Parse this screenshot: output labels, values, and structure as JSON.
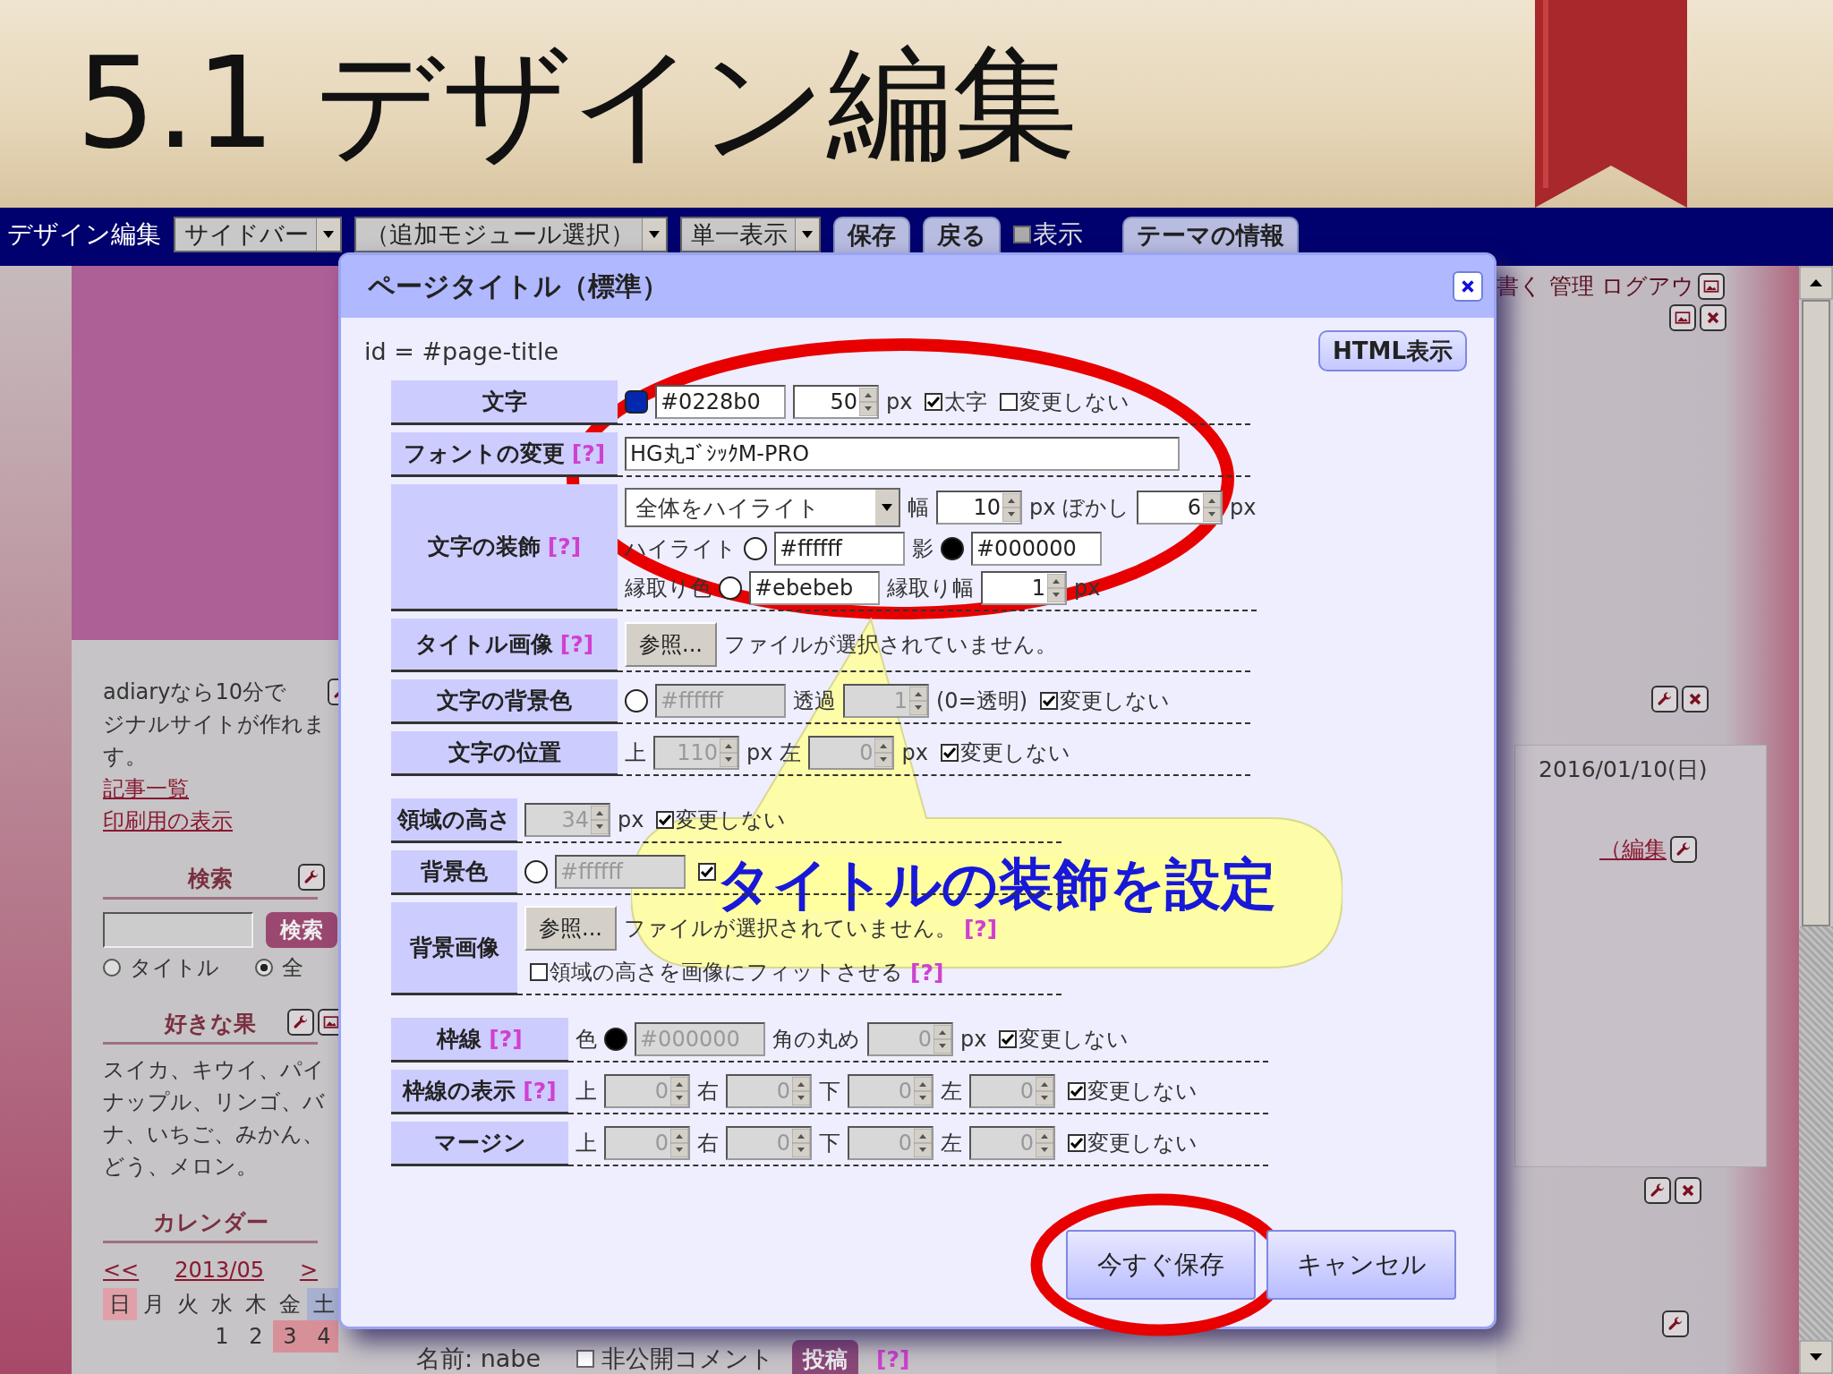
{
  "slide": {
    "title": "5.1 デザイン編集"
  },
  "toolbar": {
    "items": [
      {
        "kind": "label",
        "text": "デザイン編集"
      },
      {
        "kind": "select",
        "text": "サイドバー"
      },
      {
        "kind": "select",
        "text": "（追加モジュール選択）"
      },
      {
        "kind": "select",
        "text": "単一表示"
      },
      {
        "kind": "button",
        "text": "保存"
      },
      {
        "kind": "button",
        "text": "戻る"
      },
      {
        "kind": "checkbox",
        "text": "表示",
        "checked": false
      },
      {
        "kind": "button",
        "text": "テーマの情報"
      }
    ]
  },
  "sidebar": {
    "intro_lines": [
      "adiaryなら10分で",
      "ジナルサイトが作れま",
      "す。"
    ],
    "links": [
      "記事一覧",
      "印刷用の表示"
    ],
    "search": {
      "title": "検索",
      "button": "検索",
      "options": [
        {
          "label": "タイトル",
          "selected": false
        },
        {
          "label": "全",
          "selected": true
        }
      ]
    },
    "fruits": {
      "title": "好きな果",
      "lines": [
        "スイカ、キウイ、パイ",
        "ナップル、リンゴ、バ",
        "ナ、いちご、みかん、",
        "どう、メロン。"
      ]
    },
    "calendar": {
      "title": "カレンダー",
      "prev": "<<",
      "month": "2013/05",
      "next": ">",
      "weekdays": [
        {
          "label": "日",
          "kind": "sunday"
        },
        {
          "label": "月",
          "kind": "weekday"
        },
        {
          "label": "火",
          "kind": "weekday"
        },
        {
          "label": "水",
          "kind": "weekday"
        },
        {
          "label": "木",
          "kind": "weekday"
        },
        {
          "label": "金",
          "kind": "weekday"
        },
        {
          "label": "土",
          "kind": "saturday"
        }
      ],
      "week": [
        {
          "kind": "blank"
        },
        {
          "kind": "blank"
        },
        {
          "kind": "blank"
        },
        {
          "kind": "day",
          "label": "1",
          "holiday": false
        },
        {
          "kind": "day",
          "label": "2",
          "holiday": false
        },
        {
          "kind": "day",
          "label": "3",
          "holiday": true
        },
        {
          "kind": "day",
          "label": "4",
          "holiday": true
        }
      ]
    }
  },
  "right_panel": {
    "user_links": "書く 管理 ログアウ",
    "date": "2016/01/10(日)",
    "edit_link": "（編集"
  },
  "comment_form": {
    "name_label": "名前: nabe",
    "private": {
      "label": "非公開コメント",
      "checked": false
    },
    "submit": "投稿",
    "help": "[?]"
  },
  "dialog": {
    "title": "ページタイトル（標準）",
    "id_text": "id = #page-title",
    "html_button": "HTML表示",
    "groups": [
      {
        "rows": [
          {
            "label": "文字",
            "lines": [
              [
                {
                  "kind": "chip",
                  "color": "#0228b0"
                },
                {
                  "kind": "input",
                  "value": "#0228b0",
                  "disabled": false
                },
                {
                  "kind": "spin",
                  "value": "50",
                  "disabled": false
                },
                {
                  "kind": "text",
                  "label": "px"
                },
                {
                  "kind": "check",
                  "label": "太字",
                  "checked": true
                },
                {
                  "kind": "check",
                  "label": "変更しない",
                  "checked": false
                }
              ]
            ]
          },
          {
            "label": "フォントの変更",
            "help": "[?]",
            "lines": [
              [
                {
                  "kind": "textfield",
                  "value": "HG丸ｺﾞｼｯｸM-PRO",
                  "disabled": false
                }
              ]
            ]
          },
          {
            "label": "文字の装飾",
            "help": "[?]",
            "lines": [
              [
                {
                  "kind": "select",
                  "value": "全体をハイライト"
                },
                {
                  "kind": "text",
                  "label": "幅"
                },
                {
                  "kind": "spin",
                  "value": "10",
                  "disabled": false
                },
                {
                  "kind": "text",
                  "label": "px ぼかし"
                },
                {
                  "kind": "spin",
                  "value": "6",
                  "disabled": false
                },
                {
                  "kind": "text",
                  "label": "px"
                }
              ],
              [
                {
                  "kind": "text",
                  "label": "ハイライト"
                },
                {
                  "kind": "swatch"
                },
                {
                  "kind": "input",
                  "value": "#ffffff",
                  "disabled": false
                },
                {
                  "kind": "text",
                  "label": "影"
                },
                {
                  "kind": "swatch",
                  "color": "#000000"
                },
                {
                  "kind": "input",
                  "value": "#000000",
                  "disabled": false
                }
              ],
              [
                {
                  "kind": "text",
                  "label": "縁取り色"
                },
                {
                  "kind": "swatch"
                },
                {
                  "kind": "input",
                  "value": "#ebebeb",
                  "disabled": false
                },
                {
                  "kind": "text",
                  "label": "縁取り幅"
                },
                {
                  "kind": "spin",
                  "value": "1",
                  "disabled": false
                },
                {
                  "kind": "text",
                  "label": "px"
                }
              ]
            ]
          },
          {
            "label": "タイトル画像",
            "help": "[?]",
            "lines": [
              [
                {
                  "kind": "button",
                  "label": "参照..."
                },
                {
                  "kind": "text",
                  "label": "ファイルが選択されていません。"
                }
              ]
            ]
          },
          {
            "label": "文字の背景色",
            "lines": [
              [
                {
                  "kind": "swatch"
                },
                {
                  "kind": "input",
                  "value": "#ffffff",
                  "disabled": true
                },
                {
                  "kind": "text",
                  "label": "透過"
                },
                {
                  "kind": "spin",
                  "value": "1",
                  "disabled": true
                },
                {
                  "kind": "text",
                  "label": "(0=透明)"
                },
                {
                  "kind": "check",
                  "label": "変更しない",
                  "checked": true
                }
              ]
            ]
          },
          {
            "label": "文字の位置",
            "lines": [
              [
                {
                  "kind": "text",
                  "label": "上"
                },
                {
                  "kind": "spin",
                  "value": "110",
                  "disabled": true
                },
                {
                  "kind": "text",
                  "label": "px"
                },
                {
                  "kind": "text",
                  "label": "左"
                },
                {
                  "kind": "spin",
                  "value": "0",
                  "disabled": true
                },
                {
                  "kind": "text",
                  "label": "px"
                },
                {
                  "kind": "check",
                  "label": "変更しない",
                  "checked": true
                }
              ]
            ]
          }
        ]
      },
      {
        "rows": [
          {
            "label": "領域の高さ",
            "lines": [
              [
                {
                  "kind": "spin",
                  "value": "34",
                  "disabled": true
                },
                {
                  "kind": "text",
                  "label": "px"
                },
                {
                  "kind": "check",
                  "label": "変更しない",
                  "checked": true
                }
              ]
            ]
          },
          {
            "label": "背景色",
            "lines": [
              [
                {
                  "kind": "swatch"
                },
                {
                  "kind": "input",
                  "value": "#ffffff",
                  "disabled": true
                },
                {
                  "kind": "check",
                  "checked": true
                }
              ]
            ]
          },
          {
            "label": "背景画像",
            "lines": [
              [
                {
                  "kind": "button",
                  "label": "参照..."
                },
                {
                  "kind": "text",
                  "label": "ファイルが選択されていません。"
                },
                {
                  "kind": "help",
                  "label": "[?]"
                }
              ],
              [
                {
                  "kind": "check",
                  "label": "領域の高さを画像にフィットさせる",
                  "checked": false
                },
                {
                  "kind": "help",
                  "label": "[?]"
                }
              ]
            ]
          }
        ]
      },
      {
        "rows": [
          {
            "label": "枠線",
            "help": "[?]",
            "lines": [
              [
                {
                  "kind": "text",
                  "label": "色"
                },
                {
                  "kind": "swatch",
                  "color": "#000000"
                },
                {
                  "kind": "input",
                  "value": "#000000",
                  "disabled": true
                },
                {
                  "kind": "text",
                  "label": "角の丸め"
                },
                {
                  "kind": "spin",
                  "value": "0",
                  "disabled": true
                },
                {
                  "kind": "text",
                  "label": "px"
                },
                {
                  "kind": "check",
                  "label": "変更しない",
                  "checked": true
                }
              ]
            ]
          },
          {
            "label": "枠線の表示",
            "help": "[?]",
            "lines": [
              [
                {
                  "kind": "text",
                  "label": "上"
                },
                {
                  "kind": "spin",
                  "value": "0",
                  "disabled": true
                },
                {
                  "kind": "text",
                  "label": "右"
                },
                {
                  "kind": "spin",
                  "value": "0",
                  "disabled": true
                },
                {
                  "kind": "text",
                  "label": "下"
                },
                {
                  "kind": "spin",
                  "value": "0",
                  "disabled": true
                },
                {
                  "kind": "text",
                  "label": "左"
                },
                {
                  "kind": "spin",
                  "value": "0",
                  "disabled": true
                },
                {
                  "kind": "check",
                  "label": "変更しない",
                  "checked": true
                }
              ]
            ]
          },
          {
            "label": "マージン",
            "lines": [
              [
                {
                  "kind": "text",
                  "label": "上"
                },
                {
                  "kind": "spin",
                  "value": "0",
                  "disabled": true
                },
                {
                  "kind": "text",
                  "label": "右"
                },
                {
                  "kind": "spin",
                  "value": "0",
                  "disabled": true
                },
                {
                  "kind": "text",
                  "label": "下"
                },
                {
                  "kind": "spin",
                  "value": "0",
                  "disabled": true
                },
                {
                  "kind": "text",
                  "label": "左"
                },
                {
                  "kind": "spin",
                  "value": "0",
                  "disabled": true
                },
                {
                  "kind": "check",
                  "label": "変更しない",
                  "checked": true
                }
              ]
            ]
          }
        ]
      }
    ],
    "buttons": [
      "今すぐ保存",
      "キャンセル"
    ]
  },
  "callout": {
    "text": "タイトルの装飾を設定"
  }
}
